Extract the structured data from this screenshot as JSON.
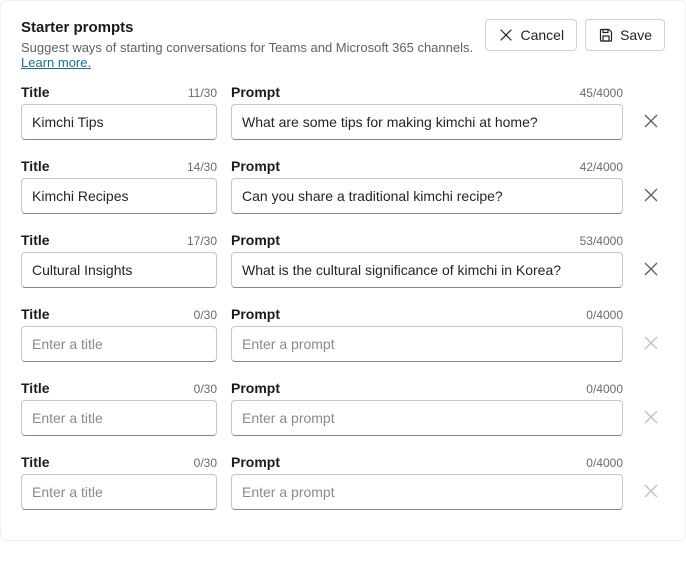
{
  "header": {
    "title": "Starter prompts",
    "subtitle": "Suggest ways of starting conversations for Teams and Microsoft 365 channels. ",
    "learn_more": "Learn more.",
    "cancel_label": "Cancel",
    "save_label": "Save"
  },
  "labels": {
    "title": "Title",
    "prompt": "Prompt",
    "title_placeholder": "Enter a title",
    "prompt_placeholder": "Enter a prompt"
  },
  "limits": {
    "title_max": 30,
    "prompt_max": 4000
  },
  "rows": [
    {
      "title": "Kimchi Tips",
      "title_count": "11/30",
      "prompt": "What are some tips for making kimchi at home?",
      "prompt_count": "45/4000",
      "deletable": true
    },
    {
      "title": "Kimchi Recipes",
      "title_count": "14/30",
      "prompt": "Can you share a traditional kimchi recipe?",
      "prompt_count": "42/4000",
      "deletable": true
    },
    {
      "title": "Cultural Insights",
      "title_count": "17/30",
      "prompt": "What is the cultural significance of kimchi in Korea?",
      "prompt_count": "53/4000",
      "deletable": true
    },
    {
      "title": "",
      "title_count": "0/30",
      "prompt": "",
      "prompt_count": "0/4000",
      "deletable": false
    },
    {
      "title": "",
      "title_count": "0/30",
      "prompt": "",
      "prompt_count": "0/4000",
      "deletable": false
    },
    {
      "title": "",
      "title_count": "0/30",
      "prompt": "",
      "prompt_count": "0/4000",
      "deletable": false
    }
  ]
}
